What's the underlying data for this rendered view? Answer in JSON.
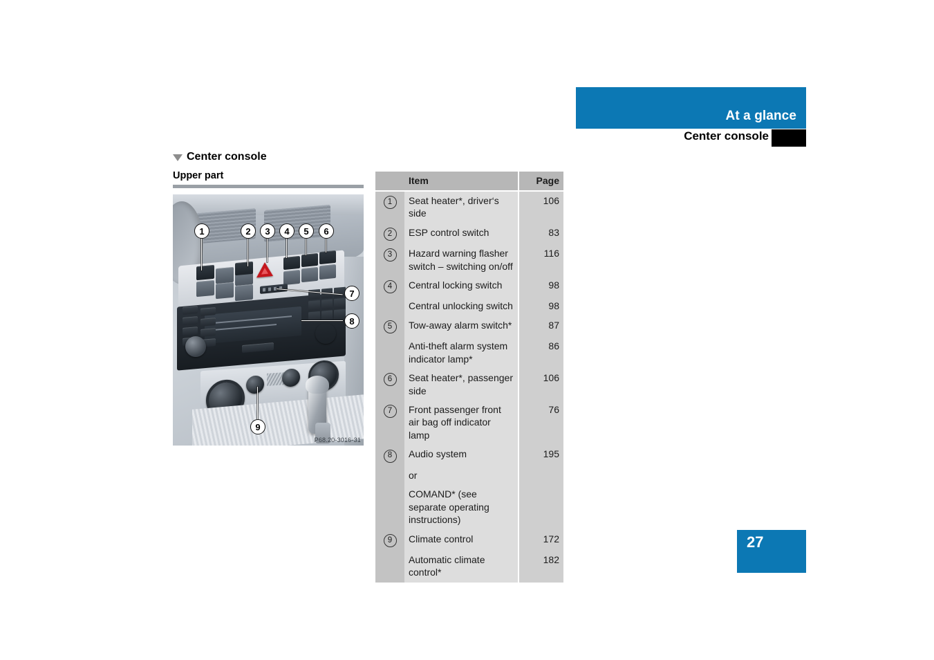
{
  "header": {
    "chapter_title": "At a glance",
    "section_title": "Center console"
  },
  "left": {
    "heading": "Center console",
    "subheading": "Upper part",
    "photo_caption": "P68.20-3016-31",
    "photo_callouts": [
      "1",
      "2",
      "3",
      "4",
      "5",
      "6",
      "7",
      "8",
      "9"
    ]
  },
  "table": {
    "columns": [
      "Item",
      "Page"
    ],
    "rows": [
      {
        "num": "1",
        "label": "Seat heater*, driver‘s side",
        "page": "106"
      },
      {
        "num": "2",
        "label": "ESP control switch",
        "page": "83"
      },
      {
        "num": "3",
        "label": "Hazard warning flasher switch – switching on/off",
        "page": "116"
      },
      {
        "num": "4",
        "label": "Central locking switch",
        "page": "98"
      },
      {
        "num": "",
        "label": "Central unlocking switch",
        "page": "98"
      },
      {
        "num": "5",
        "label": "Tow-away alarm switch*",
        "page": "87"
      },
      {
        "num": "",
        "label": "Anti-theft alarm system indicator lamp*",
        "page": "86"
      },
      {
        "num": "6",
        "label": "Seat heater*, passenger side",
        "page": "106"
      },
      {
        "num": "7",
        "label": "Front passenger front air bag off indicator lamp",
        "page": "76"
      },
      {
        "num": "8",
        "label": "Audio system",
        "page": "195"
      },
      {
        "num": "",
        "label": "or",
        "page": ""
      },
      {
        "num": "",
        "label": "COMAND* (see separate operating instructions)",
        "page": ""
      },
      {
        "num": "9",
        "label": "Climate control",
        "page": "172"
      },
      {
        "num": "",
        "label": "Automatic climate control*",
        "page": "182"
      }
    ]
  },
  "footer": {
    "page_number": "27"
  },
  "colors": {
    "accent_blue": "#0c78b4",
    "tab_black": "#000000",
    "table_header_gray": "#b7b7b7",
    "table_num_gray": "#c3c3c3",
    "table_label_gray": "#dddddd",
    "table_page_gray": "#cfcfcf"
  }
}
